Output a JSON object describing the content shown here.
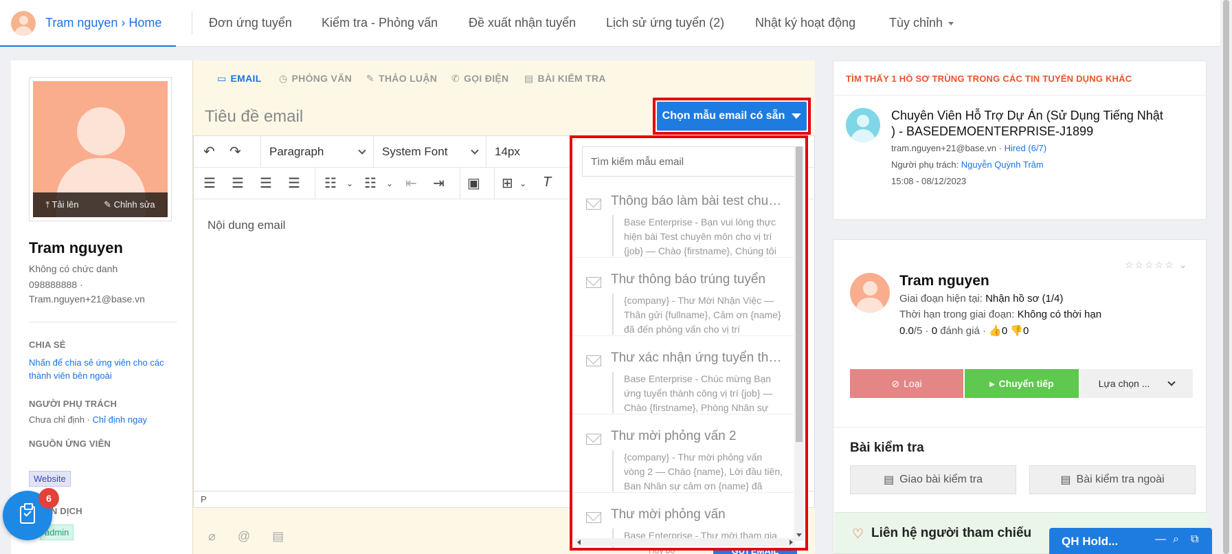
{
  "nav": {
    "breadcrumb": "Tram nguyen › Home",
    "tabs": [
      "Đơn ứng tuyển",
      "Kiểm tra - Phỏng vấn",
      "Đề xuất nhận tuyển",
      "Lịch sử ứng tuyển (2)",
      "Nhật ký hoạt động",
      "Tùy chỉnh"
    ]
  },
  "profile": {
    "upload": "Tải lên",
    "edit": "Chỉnh sửa",
    "name": "Tram nguyen",
    "title": "Không có chức danh",
    "phone": "098888888 ·",
    "email": "Tram.nguyen+21@base.vn",
    "share_head": "CHIA SẺ",
    "share_link": "Nhấn để chia sẻ ứng viên cho các thành viên bên ngoài",
    "owner_head": "NGƯỜI PHỤ TRÁCH",
    "owner_none": "Chưa chỉ định ·",
    "owner_assign": "Chỉ định ngay",
    "source_head": "NGUỒN ỨNG VIÊN",
    "source_tag": "Website",
    "campaign_head": "CHIẾN DỊCH",
    "campaign_tag": "admin",
    "task_count": "6"
  },
  "composer": {
    "tabs": [
      "EMAIL",
      "PHỎNG VẤN",
      "THẢO LUẬN",
      "GỌI ĐIỆN",
      "BÀI KIỂM TRA"
    ],
    "subject_placeholder": "Tiêu đề email",
    "template_button": "Chọn mẫu email có sẵn",
    "block_format": "Paragraph",
    "font_family": "System Font",
    "font_size": "14px",
    "content_placeholder": "Nội dung email",
    "status_path": "P",
    "footer_hint": "Hủy bỏ",
    "send_label": "GỬI EMAIL"
  },
  "templates": {
    "search_placeholder": "Tìm kiếm mẫu email",
    "items": [
      {
        "title": "Thông báo làm bài test chuyên môn",
        "desc": "Base Enterprise - Bạn vui lòng thực hiện bài Test chuyên môn cho vị trí {job} — Chào {firstname}, Chúng tôi"
      },
      {
        "title": "Thư thông báo trúng tuyển",
        "desc": "{company} - Thư Mời Nhận Việc — Thân gửi {fullname}, Cảm ơn {name} đã đến phỏng vấn cho vị trí"
      },
      {
        "title": "Thư xác nhận ứng tuyển thành công",
        "desc": "Base Enterprise - Chúc mừng Bạn ứng tuyển thành công vị trí {job} — Chào {firstname}, Phòng Nhân sự"
      },
      {
        "title": "Thư mời phỏng vấn 2",
        "desc": "{company} - Thư mời phỏng vấn vòng 2 — Chào {name}, Lời đầu tiên, Ban Nhân sự cảm ơn {name} đã"
      },
      {
        "title": "Thư mời phỏng vấn",
        "desc": "Base Enterprise - Thư mời tham gia"
      }
    ]
  },
  "duplicate": {
    "heading": "TÌM THẤY 1 HỒ SƠ TRÙNG TRONG CÁC TIN TUYỂN DỤNG KHÁC",
    "job_title": "Chuyên Viên Hỗ Trợ Dự Án (Sử Dụng Tiếng Nhật ) - BASEDEMOENTERPRISE-J1899",
    "email": "tram.nguyen+21@base.vn ·",
    "status": "Hired (6/7)",
    "owner_label": "Người phụ trách:",
    "owner": "Nguyễn Quỳnh Trâm",
    "datetime": "15:08 - 08/12/2023"
  },
  "candidate": {
    "stars": "☆☆☆☆☆",
    "name": "Tram nguyen",
    "stage_label": "Giai đoạn hiện tại:",
    "stage": "Nhận hồ sơ (1/4)",
    "deadline_label": "Thời hạn trong giai đoạn:",
    "deadline": "Không có thời hạn",
    "score": "0.0",
    "score_max": "/5 ·",
    "reviews": "0",
    "reviews_label": "đánh giá ·",
    "likes": "0",
    "dislikes": "0",
    "reject": "Loại",
    "next": "Chuyển tiếp",
    "more": "Lựa chọn ...",
    "test_heading": "Bài kiểm tra",
    "assign_test": "Giao bài kiểm tra",
    "external_test": "Bài kiểm tra ngoài",
    "reference": "Liên hệ người tham chiếu"
  },
  "chat": {
    "title": "QH Hold..."
  },
  "colors": {
    "accent": "#1a73e8",
    "highlight": "#e3000f",
    "reject": "#e58686",
    "next": "#5fc84e"
  }
}
